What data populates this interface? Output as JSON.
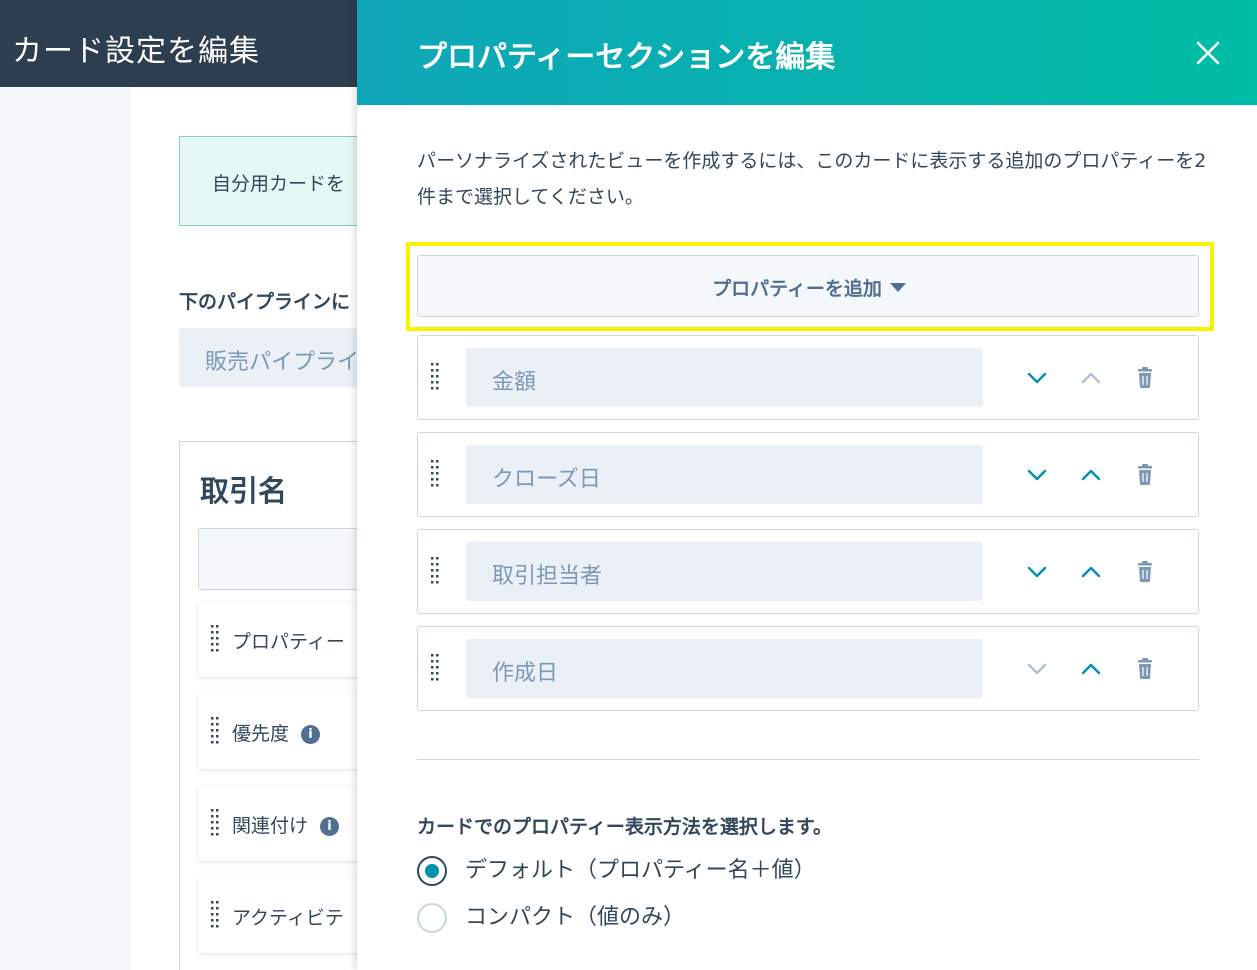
{
  "background": {
    "header_title": "カード設定を編集",
    "info_text": "自分用カードを",
    "pipeline_label": "下のパイプラインに",
    "pipeline_value": "販売パイプライ",
    "card_title": "取引名",
    "items": [
      {
        "label": "プロパティー",
        "info": false
      },
      {
        "label": "優先度",
        "info": true
      },
      {
        "label": "関連付け",
        "info": true
      },
      {
        "label": "アクティビテ",
        "info": false
      }
    ]
  },
  "panel": {
    "title": "プロパティーセクションを編集",
    "description": "パーソナライズされたビューを作成するには、このカードに表示する追加のプロパティーを2件まで選択してください。",
    "add_button_label": "プロパティーを追加",
    "properties": [
      {
        "name": "金額",
        "down_enabled": true,
        "up_enabled": false
      },
      {
        "name": "クローズ日",
        "down_enabled": true,
        "up_enabled": true
      },
      {
        "name": "取引担当者",
        "down_enabled": true,
        "up_enabled": true
      },
      {
        "name": "作成日",
        "down_enabled": false,
        "up_enabled": true
      }
    ],
    "display_label": "カードでのプロパティー表示方法を選択します。",
    "display_options": [
      {
        "label": "デフォルト（プロパティー名＋値）",
        "selected": true
      },
      {
        "label": "コンパクト（値のみ）",
        "selected": false
      }
    ]
  },
  "colors": {
    "accent_teal": "#00a4bd",
    "enabled_arrow": "#0091ae",
    "disabled_arrow": "#b0c1d4",
    "highlight": "#f8f200"
  }
}
